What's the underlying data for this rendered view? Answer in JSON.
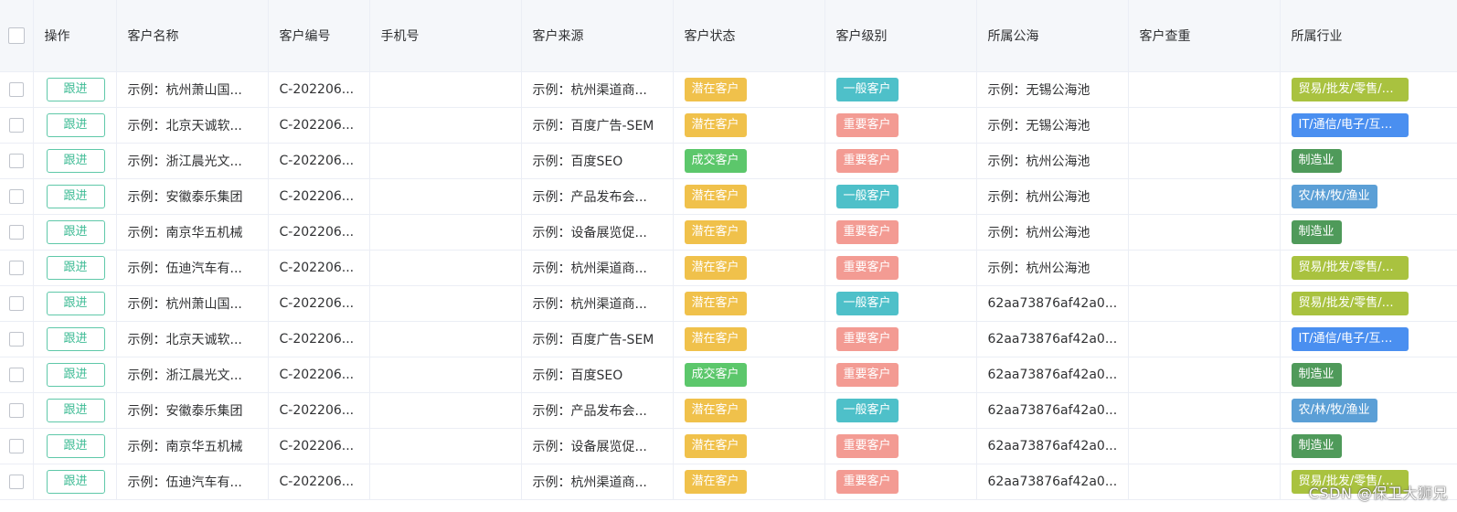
{
  "table": {
    "headers": {
      "action": "操作",
      "name": "客户名称",
      "code": "客户编号",
      "phone": "手机号",
      "source": "客户来源",
      "status": "客户状态",
      "level": "客户级别",
      "pool": "所属公海",
      "dedupe": "客户查重",
      "industry": "所属行业"
    },
    "follow_label": "跟进",
    "rows": [
      {
        "name": "示例：杭州萧山国...",
        "code": "C-202206...",
        "phone": "",
        "source": "示例：杭州渠道商...",
        "status": "潜在客户",
        "level": "一般客户",
        "pool": "示例：无锡公海池",
        "dedupe": "",
        "industry": "贸易/批发/零售/租..."
      },
      {
        "name": "示例：北京天诚软...",
        "code": "C-202206...",
        "phone": "",
        "source": "示例：百度广告-SEM",
        "status": "潜在客户",
        "level": "重要客户",
        "pool": "示例：无锡公海池",
        "dedupe": "",
        "industry": "IT/通信/电子/互联..."
      },
      {
        "name": "示例：浙江晨光文...",
        "code": "C-202206...",
        "phone": "",
        "source": "示例：百度SEO",
        "status": "成交客户",
        "level": "重要客户",
        "pool": "示例：杭州公海池",
        "dedupe": "",
        "industry": "制造业"
      },
      {
        "name": "示例：安徽泰乐集团",
        "code": "C-202206...",
        "phone": "",
        "source": "示例：产品发布会...",
        "status": "潜在客户",
        "level": "一般客户",
        "pool": "示例：杭州公海池",
        "dedupe": "",
        "industry": "农/林/牧/渔业"
      },
      {
        "name": "示例：南京华五机械",
        "code": "C-202206...",
        "phone": "",
        "source": "示例：设备展览促...",
        "status": "潜在客户",
        "level": "重要客户",
        "pool": "示例：杭州公海池",
        "dedupe": "",
        "industry": "制造业"
      },
      {
        "name": "示例：伍迪汽车有...",
        "code": "C-202206...",
        "phone": "",
        "source": "示例：杭州渠道商...",
        "status": "潜在客户",
        "level": "重要客户",
        "pool": "示例：杭州公海池",
        "dedupe": "",
        "industry": "贸易/批发/零售/租..."
      },
      {
        "name": "示例：杭州萧山国...",
        "code": "C-202206...",
        "phone": "",
        "source": "示例：杭州渠道商...",
        "status": "潜在客户",
        "level": "一般客户",
        "pool": "62aa73876af42a0...",
        "dedupe": "",
        "industry": "贸易/批发/零售/租..."
      },
      {
        "name": "示例：北京天诚软...",
        "code": "C-202206...",
        "phone": "",
        "source": "示例：百度广告-SEM",
        "status": "潜在客户",
        "level": "重要客户",
        "pool": "62aa73876af42a0...",
        "dedupe": "",
        "industry": "IT/通信/电子/互联..."
      },
      {
        "name": "示例：浙江晨光文...",
        "code": "C-202206...",
        "phone": "",
        "source": "示例：百度SEO",
        "status": "成交客户",
        "level": "重要客户",
        "pool": "62aa73876af42a0...",
        "dedupe": "",
        "industry": "制造业"
      },
      {
        "name": "示例：安徽泰乐集团",
        "code": "C-202206...",
        "phone": "",
        "source": "示例：产品发布会...",
        "status": "潜在客户",
        "level": "一般客户",
        "pool": "62aa73876af42a0...",
        "dedupe": "",
        "industry": "农/林/牧/渔业"
      },
      {
        "name": "示例：南京华五机械",
        "code": "C-202206...",
        "phone": "",
        "source": "示例：设备展览促...",
        "status": "潜在客户",
        "level": "重要客户",
        "pool": "62aa73876af42a0...",
        "dedupe": "",
        "industry": "制造业"
      },
      {
        "name": "示例：伍迪汽车有...",
        "code": "C-202206...",
        "phone": "",
        "source": "示例：杭州渠道商...",
        "status": "潜在客户",
        "level": "重要客户",
        "pool": "62aa73876af42a0...",
        "dedupe": "",
        "industry": "贸易/批发/零售/租..."
      }
    ]
  },
  "tag_colors": {
    "潜在客户": "#f0c14b",
    "成交客户": "#5cc76b",
    "一般客户": "#4ec0c9",
    "重要客户": "#f39b93",
    "贸易/批发/零售/租...": "#a9c23f",
    "IT/通信/电子/互联...": "#4a8ff0",
    "制造业": "#4f9a5a",
    "农/林/牧/渔业": "#5b9fd6"
  },
  "colors": {
    "follow_button": "#3dbb94",
    "header_bg": "#f5f7fa",
    "border": "#ebeef5"
  },
  "watermark": "CSDN @保卫大狮兄"
}
